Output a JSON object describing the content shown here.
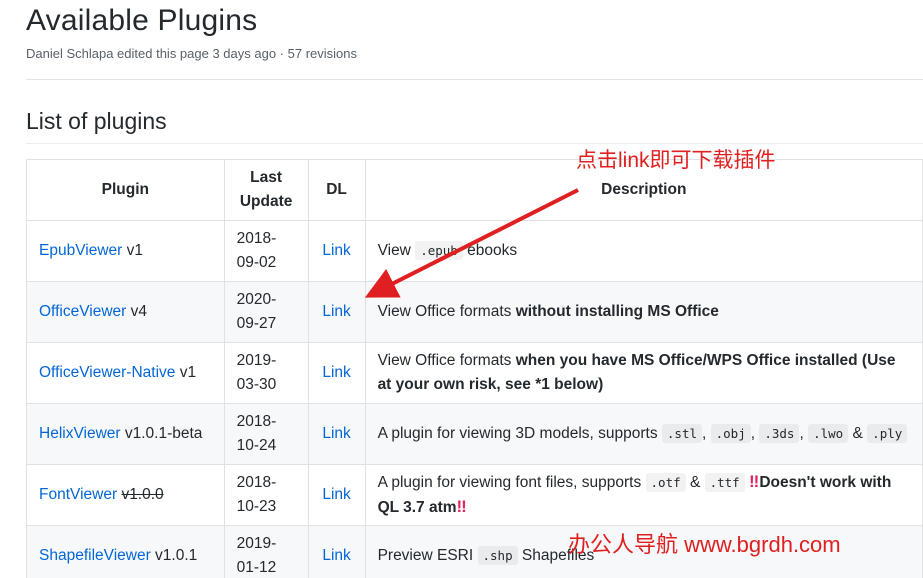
{
  "page": {
    "title": "Available Plugins",
    "meta": "Daniel Schlapa edited this page 3 days ago · 57 revisions",
    "section_title": "List of plugins"
  },
  "table": {
    "headers": {
      "plugin": "Plugin",
      "last_update_1": "Last",
      "last_update_2": "Update",
      "dl": "DL",
      "description": "Description"
    },
    "rows": [
      {
        "name": "EpubViewer",
        "version": "v1",
        "date_1": "2018-",
        "date_2": "09-02",
        "dl": "Link",
        "desc": {
          "a": "View",
          "code1": ".epub",
          "b": "ebooks"
        }
      },
      {
        "name": "OfficeViewer",
        "version": "v4",
        "date_1": "2020-",
        "date_2": "09-27",
        "dl": "Link",
        "desc": {
          "a": "View Office formats",
          "strong1": "without installing MS Office"
        }
      },
      {
        "name": "OfficeViewer-Native",
        "version": "v1",
        "date_1": "2019-",
        "date_2": "03-30",
        "dl": "Link",
        "desc": {
          "a": "View Office formats",
          "strong1": "when you have MS Office/WPS Office installed (Use at your own risk, see *1 below)"
        }
      },
      {
        "name": "HelixViewer",
        "version": "v1.0.1-beta",
        "date_1": "2018-",
        "date_2": "10-24",
        "dl": "Link",
        "desc": {
          "a": "A plugin for viewing 3D models, supports",
          "code1": ".stl",
          "code2": ".obj",
          "code3": ".3ds",
          "code4": ".lwo",
          "amp": "&",
          "code5": ".ply"
        }
      },
      {
        "name": "FontViewer",
        "version": "v1.0.0",
        "date_1": "2018-",
        "date_2": "10-23",
        "dl": "Link",
        "desc": {
          "a": "A plugin for viewing font files, supports",
          "code1": ".otf",
          "amp": "&",
          "code2": ".ttf",
          "bang": "‼",
          "strong1": "Doesn't work with QL 3.7 atm",
          "bang2": "‼"
        }
      },
      {
        "name": "ShapefileViewer",
        "version": "v1.0.1",
        "date_1": "2019-",
        "date_2": "01-12",
        "dl": "Link",
        "desc": {
          "a": "Preview ESRI",
          "code1": ".shp",
          "b": "Shapefiles"
        }
      }
    ]
  },
  "annotations": {
    "top": "点击link即可下载插件",
    "bottom": "办公人导航 www.bgrdh.com",
    "color": "#e02020"
  },
  "colors": {
    "link": "#0366d6",
    "text": "#24292e",
    "muted": "#586069",
    "border": "#dfe2e5",
    "stripe": "#f6f8fa"
  }
}
